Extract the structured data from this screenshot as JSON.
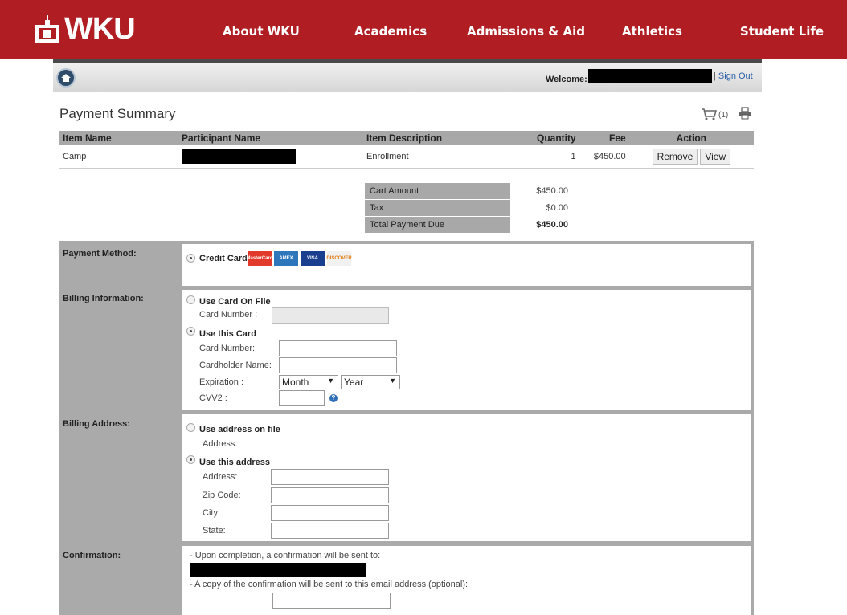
{
  "brand": {
    "logo_text": "WKU"
  },
  "nav": [
    "About WKU",
    "Academics",
    "Admissions & Aid",
    "Athletics",
    "Student Life"
  ],
  "header": {
    "welcome_label": "Welcome:",
    "separator": "|",
    "sign_out": "Sign Out"
  },
  "page_title": "Payment Summary",
  "cart": {
    "count": "(1)"
  },
  "items_table": {
    "columns": [
      "Item Name",
      "Participant Name",
      "Item Description",
      "Quantity",
      "Fee",
      "Action"
    ],
    "rows": [
      {
        "item_name": "Camp",
        "description": "Enrollment",
        "quantity": "1",
        "fee": "$450.00",
        "remove": "Remove",
        "view": "View"
      }
    ]
  },
  "summary": {
    "cart_amount_label": "Cart Amount",
    "cart_amount": "$450.00",
    "tax_label": "Tax",
    "tax": "$0.00",
    "total_label": "Total Payment Due",
    "total": "$450.00"
  },
  "payment_method": {
    "label": "Payment Method:",
    "option": "Credit Card",
    "cards": [
      "MasterCard",
      "AMEX",
      "VISA",
      "DISCOVER"
    ]
  },
  "billing_info": {
    "label": "Billing Information:",
    "use_on_file": "Use Card On File",
    "card_number_on_file": "Card Number :",
    "use_this": "Use this Card",
    "card_number": "Card Number:",
    "cardholder": "Cardholder Name:",
    "expiration": "Expiration :",
    "month": "Month",
    "year": "Year",
    "cvv": "CVV2 :"
  },
  "billing_address": {
    "label": "Billing Address:",
    "use_on_file": "Use address on file",
    "address_on_file": "Address:",
    "use_this": "Use this address",
    "address": "Address:",
    "zip": "Zip Code:",
    "city": "City:",
    "state": "State:"
  },
  "confirmation": {
    "label": "Confirmation:",
    "line1": "- Upon completion, a confirmation will be sent to:",
    "line2": "- A copy of the confirmation will be sent to this email address (optional):"
  },
  "colors": {
    "brand_red": "#b01e24",
    "table_header": "#a8a8a8"
  }
}
